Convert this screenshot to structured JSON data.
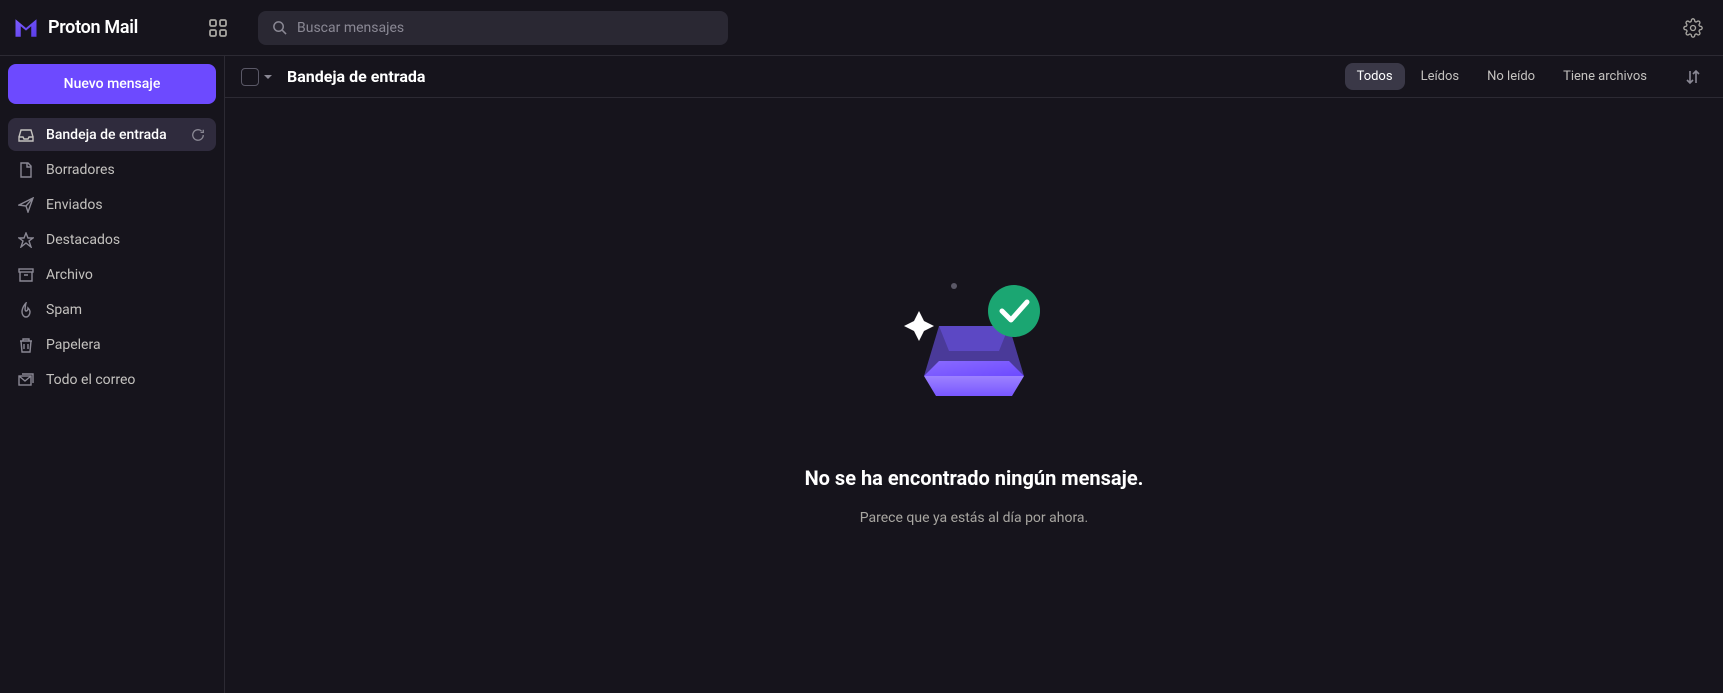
{
  "app": {
    "name": "Proton Mail"
  },
  "search": {
    "placeholder": "Buscar mensajes"
  },
  "compose": {
    "label": "Nuevo mensaje"
  },
  "sidebar": {
    "items": [
      {
        "label": "Bandeja de entrada",
        "icon": "inbox-icon",
        "active": true,
        "hasRefresh": true
      },
      {
        "label": "Borradores",
        "icon": "file-icon"
      },
      {
        "label": "Enviados",
        "icon": "send-icon"
      },
      {
        "label": "Destacados",
        "icon": "star-icon"
      },
      {
        "label": "Archivo",
        "icon": "archive-icon"
      },
      {
        "label": "Spam",
        "icon": "fire-icon"
      },
      {
        "label": "Papelera",
        "icon": "trash-icon"
      },
      {
        "label": "Todo el correo",
        "icon": "envelopes-icon"
      }
    ]
  },
  "toolbar": {
    "folder_title": "Bandeja de entrada",
    "filters": [
      {
        "label": "Todos",
        "active": true
      },
      {
        "label": "Leídos"
      },
      {
        "label": "No leído"
      },
      {
        "label": "Tiene archivos"
      }
    ]
  },
  "empty": {
    "title": "No se ha encontrado ningún mensaje.",
    "subtitle": "Parece que ya estás al día por ahora."
  }
}
